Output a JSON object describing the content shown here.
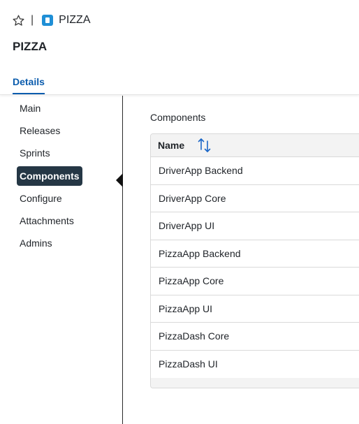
{
  "breadcrumb": {
    "separator": "|",
    "project": "PIZZA"
  },
  "page": {
    "title": "PIZZA"
  },
  "tabs": [
    {
      "label": "Details",
      "active": true
    }
  ],
  "sidebar": {
    "items": [
      {
        "label": "Main",
        "active": false
      },
      {
        "label": "Releases",
        "active": false
      },
      {
        "label": "Sprints",
        "active": false
      },
      {
        "label": "Components",
        "active": true
      },
      {
        "label": "Configure",
        "active": false
      },
      {
        "label": "Attachments",
        "active": false
      },
      {
        "label": "Admins",
        "active": false
      }
    ]
  },
  "components": {
    "section_label": "Components",
    "columns": [
      {
        "label": "Name",
        "sortable": true
      }
    ],
    "rows": [
      "DriverApp Backend",
      "DriverApp Core",
      "DriverApp UI",
      "PizzaApp Backend",
      "PizzaApp Core",
      "PizzaApp UI",
      "PizzaDash Core",
      "PizzaDash UI"
    ]
  },
  "colors": {
    "accent": "#0b5cad",
    "active_nav_bg": "#253745",
    "project_icon": "#1f8fd6",
    "sort_icon": "#1a66c7"
  },
  "icons": {
    "favorite": "star-outline-icon",
    "project": "project-board-icon",
    "sort": "sort-arrows-icon"
  }
}
